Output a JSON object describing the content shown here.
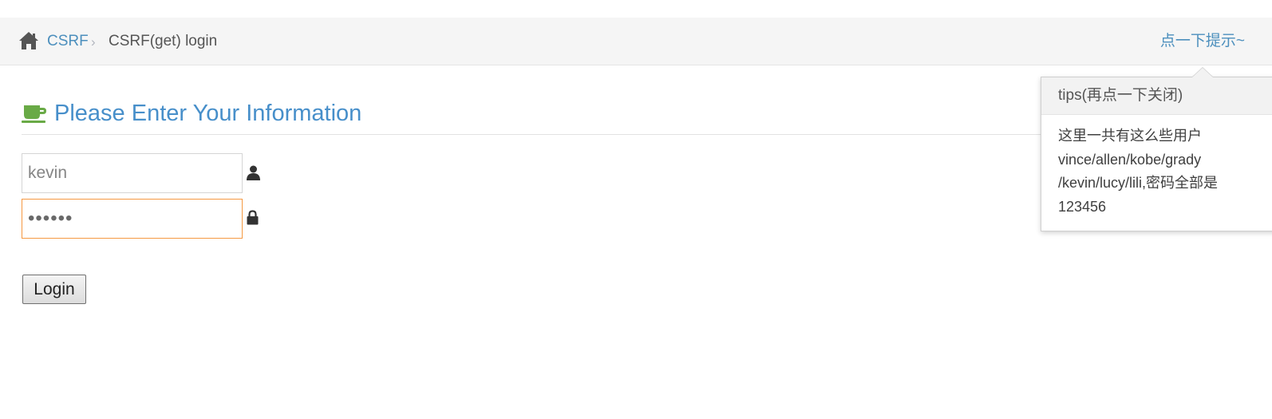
{
  "breadcrumb": {
    "home_icon": "home-icon",
    "link_label": "CSRF",
    "separator": "›",
    "current_label": "CSRF(get) login"
  },
  "hint": {
    "label": "点一下提示~"
  },
  "form": {
    "heading_icon": "coffee-cup-icon",
    "heading": "Please Enter Your Information",
    "username_value": "kevin",
    "password_value": "123456",
    "login_label": "Login"
  },
  "popover": {
    "title": "tips(再点一下关闭)",
    "lines": [
      "这里一共有这么些用户",
      "vince/allen/kobe/grady",
      "/kevin/lucy/lili,密码全部是",
      "123456"
    ]
  },
  "colors": {
    "link": "#4c8fbd",
    "heading": "#478fca",
    "icon_green": "#69aa46",
    "focus_border": "#f59942"
  }
}
